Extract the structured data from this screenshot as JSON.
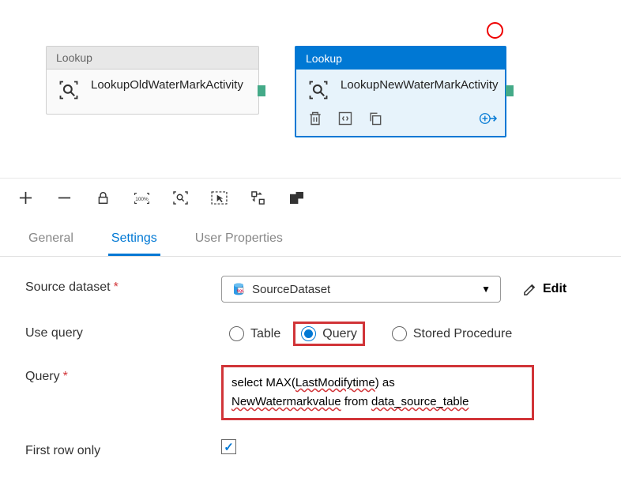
{
  "canvas": {
    "activities": [
      {
        "type": "Lookup",
        "name": "LookupOldWaterMarkActivity"
      },
      {
        "type": "Lookup",
        "name": "LookupNewWaterMarkActivity"
      }
    ]
  },
  "tabs": {
    "general": "General",
    "settings": "Settings",
    "userprops": "User Properties"
  },
  "settings": {
    "sourceDatasetLabel": "Source dataset",
    "sourceDatasetValue": "SourceDataset",
    "editLabel": "Edit",
    "useQueryLabel": "Use query",
    "useQueryOptions": {
      "table": "Table",
      "query": "Query",
      "sp": "Stored Procedure"
    },
    "queryLabel": "Query",
    "queryLine1a": "select MAX(",
    "queryLine1b": "LastModifytime",
    "queryLine1c": ") as",
    "queryLine2a": "NewWatermarkvalue",
    "queryLine2b": " from ",
    "queryLine2c": "data_source_table",
    "firstRowOnlyLabel": "First row only"
  }
}
